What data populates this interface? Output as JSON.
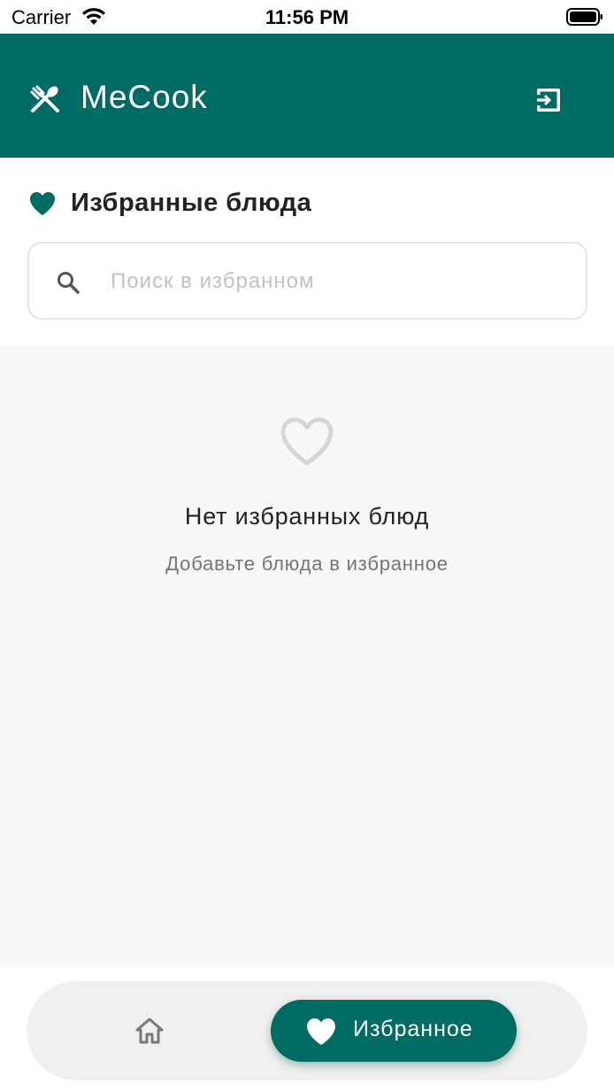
{
  "status_bar": {
    "carrier": "Carrier",
    "time": "11:56 PM",
    "icons": [
      "wifi-icon",
      "battery-icon"
    ]
  },
  "app_bar": {
    "title": "MeCook",
    "background": "#006b62",
    "logo_icon": "fork-spoon-icon",
    "action_icon": "logout-icon"
  },
  "favorites": {
    "title": "Избранные блюда",
    "title_icon": "heart-icon",
    "search": {
      "placeholder": "Поиск в избранном",
      "value": ""
    },
    "empty_state": {
      "icon": "heart-outline-icon",
      "title": "Нет избранных блюд",
      "subtitle": "Добавьте блюда в избранное"
    }
  },
  "bottom_nav": {
    "items": [
      {
        "icon": "home-icon",
        "label": "",
        "active": false
      },
      {
        "icon": "heart-icon",
        "label": "Избранное",
        "active": true
      }
    ],
    "accent": "#006b62"
  }
}
